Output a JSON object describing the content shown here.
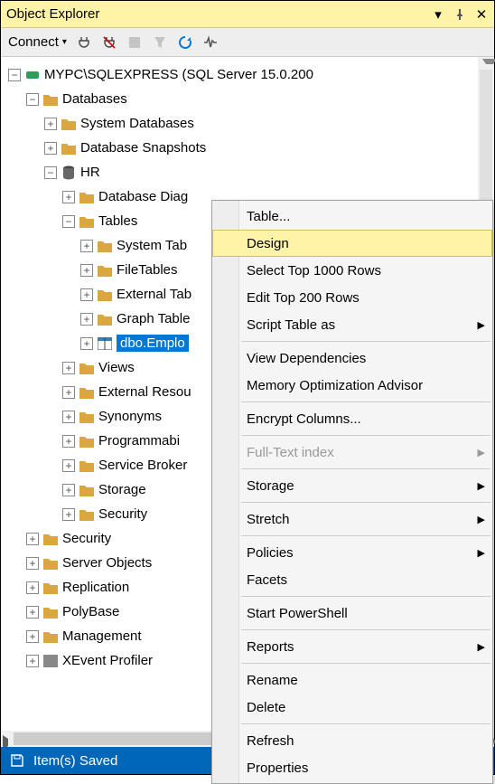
{
  "title": "Object Explorer",
  "toolbar": {
    "connect_label": "Connect"
  },
  "tree": {
    "server": "MYPC\\SQLEXPRESS (SQL Server 15.0.200",
    "databases": "Databases",
    "sys_db": "System Databases",
    "db_snap": "Database Snapshots",
    "hr": "HR",
    "db_diag": "Database Diag",
    "tables": "Tables",
    "sys_tab": "System Tab",
    "filetab": "FileTables",
    "ext_tab": "External Tab",
    "graph_tab": "Graph Table",
    "employee": "dbo.Emplo",
    "views": "Views",
    "ext_res": "External Resou",
    "synonyms": "Synonyms",
    "programmab": "Programmabi",
    "svc_broker": "Service Broker",
    "storage": "Storage",
    "security_db": "Security",
    "security": "Security",
    "server_obj": "Server Objects",
    "replication": "Replication",
    "polybase": "PolyBase",
    "management": "Management",
    "xevent": "XEvent Profiler"
  },
  "ctx": {
    "table": "Table...",
    "design": "Design",
    "select1000": "Select Top 1000 Rows",
    "edit200": "Edit Top 200 Rows",
    "script_as": "Script Table as",
    "view_dep": "View Dependencies",
    "mem_opt": "Memory Optimization Advisor",
    "encrypt": "Encrypt Columns...",
    "fulltext": "Full-Text index",
    "storage": "Storage",
    "stretch": "Stretch",
    "policies": "Policies",
    "facets": "Facets",
    "powershell": "Start PowerShell",
    "reports": "Reports",
    "rename": "Rename",
    "delete": "Delete",
    "refresh": "Refresh",
    "properties": "Properties"
  },
  "status": "Item(s) Saved"
}
